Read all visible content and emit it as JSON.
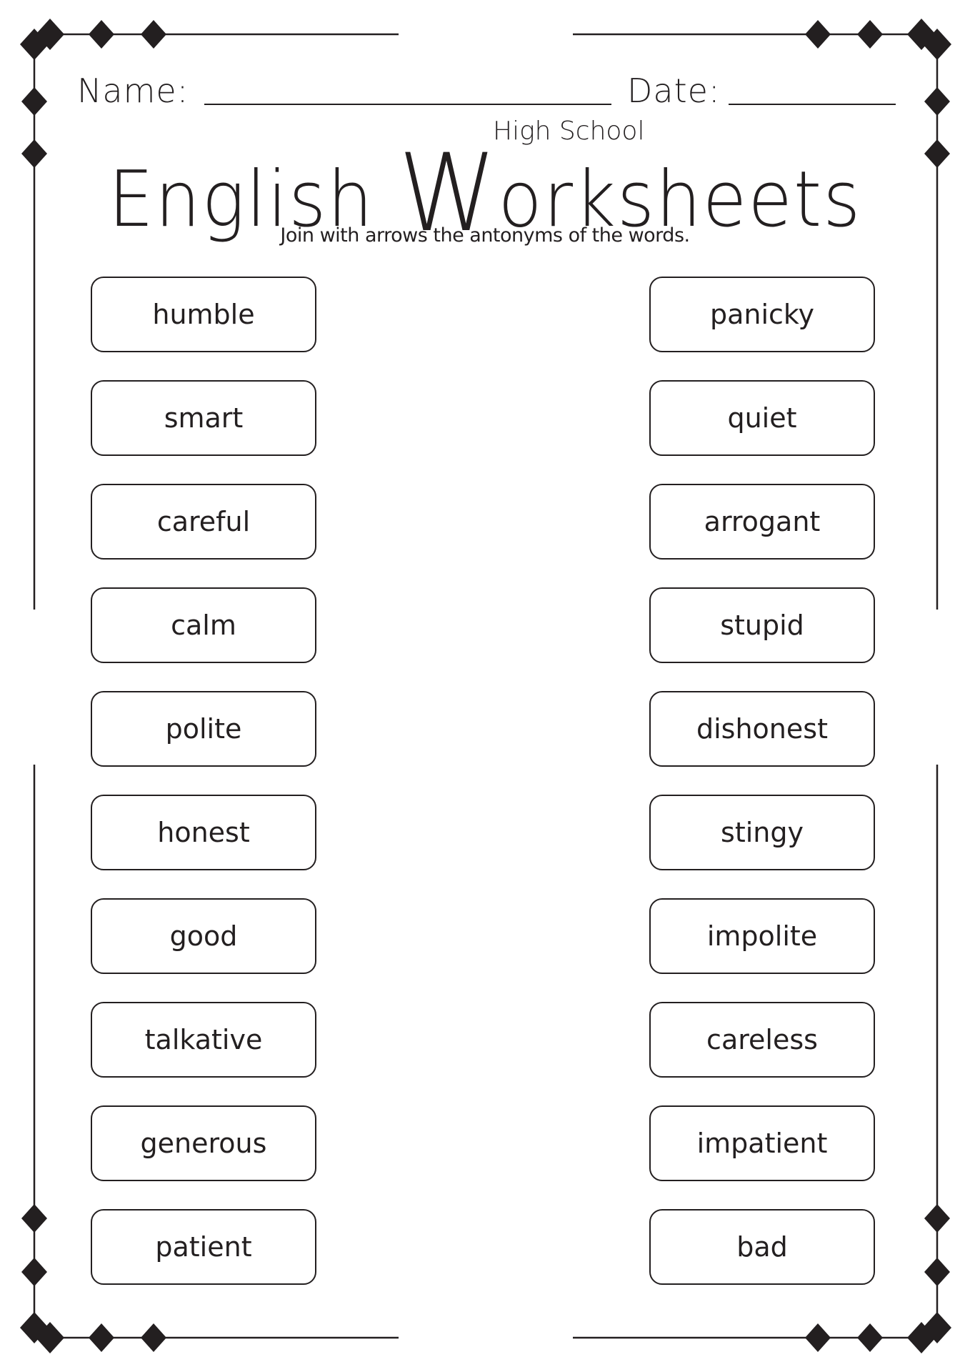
{
  "header": {
    "name_label": "Name:",
    "date_label": "Date:",
    "subtitle": "High School",
    "title_part1": "English ",
    "title_w": "W",
    "title_part2": "orksheets",
    "instruction": "Join with arrows the antonyms of the words."
  },
  "left_words": [
    "humble",
    "smart",
    "careful",
    "calm",
    "polite",
    "honest",
    "good",
    "talkative",
    "generous",
    "patient"
  ],
  "right_words": [
    "panicky",
    "quiet",
    "arrogant",
    "stupid",
    "dishonest",
    "stingy",
    "impolite",
    "careless",
    "impatient",
    "bad"
  ],
  "colors": {
    "ink": "#231f20",
    "paper": "#ffffff"
  }
}
